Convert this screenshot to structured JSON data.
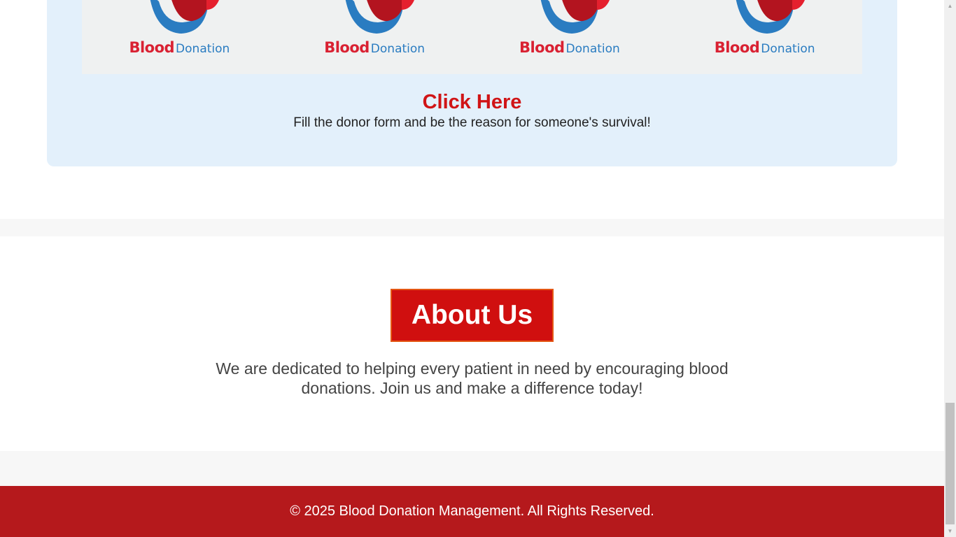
{
  "donor_section": {
    "logos": [
      {
        "word1": "Blood",
        "word2": "Donation"
      },
      {
        "word1": "Blood",
        "word2": "Donation"
      },
      {
        "word1": "Blood",
        "word2": "Donation"
      },
      {
        "word1": "Blood",
        "word2": "Donation"
      }
    ],
    "cta_title": "Click Here",
    "cta_subtitle": "Fill the donor form and be the reason for someone's survival!"
  },
  "about": {
    "heading": "About Us",
    "text": "We are dedicated to helping every patient in need by encouraging blood donations. Join us and make a difference today!"
  },
  "footer": {
    "text": "© 2025 Blood Donation Management. All Rights Reserved."
  },
  "colors": {
    "brand_red": "#d00f0f",
    "footer_red": "#b5191c",
    "card_blue": "#e3f0fb",
    "logo_blue": "#2a7cc1"
  },
  "icons": {
    "logo": "blood-donation-hand-drop-logo",
    "scroll_up": "scroll-up-arrow-icon",
    "scroll_down": "scroll-down-arrow-icon"
  }
}
